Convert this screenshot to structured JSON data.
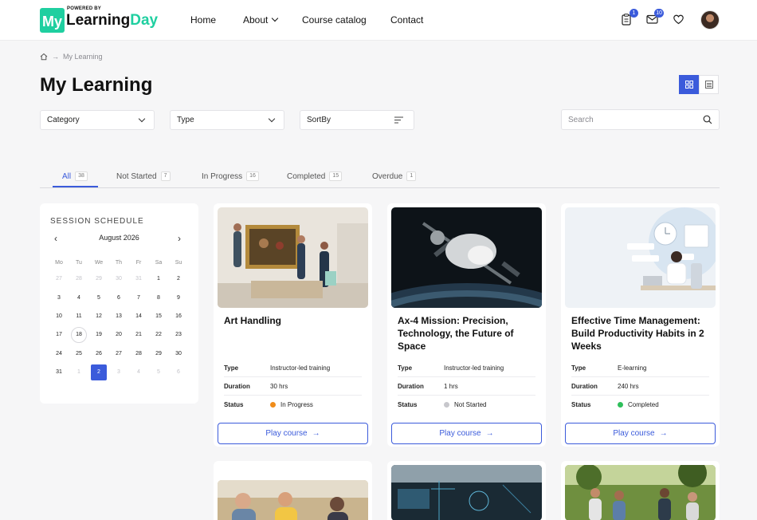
{
  "brand": {
    "powered": "POWERED BY",
    "my": "My",
    "learning": "Learning",
    "day": "Day",
    "accent": "#1fcfa0"
  },
  "nav": {
    "home": "Home",
    "about": "About",
    "catalog": "Course catalog",
    "contact": "Contact"
  },
  "header_badges": {
    "tasks": "1",
    "mail": "10"
  },
  "breadcrumb": {
    "current": "My Learning"
  },
  "page": {
    "title": "My Learning"
  },
  "filters": {
    "category": "Category",
    "type": "Type",
    "sortby": "SortBy",
    "search_placeholder": "Search"
  },
  "tabs": [
    {
      "label": "All",
      "count": "38"
    },
    {
      "label": "Not Started",
      "count": "7"
    },
    {
      "label": "In Progress",
      "count": "16"
    },
    {
      "label": "Completed",
      "count": "15"
    },
    {
      "label": "Overdue",
      "count": "1"
    }
  ],
  "calendar": {
    "heading": "SESSION SCHEDULE",
    "month": "August 2026",
    "dow": [
      "Mo",
      "Tu",
      "We",
      "Th",
      "Fr",
      "Sa",
      "Su"
    ],
    "weeks": [
      [
        "27",
        "28",
        "29",
        "30",
        "31",
        "1",
        "2"
      ],
      [
        "3",
        "4",
        "5",
        "6",
        "7",
        "8",
        "9"
      ],
      [
        "10",
        "11",
        "12",
        "13",
        "14",
        "15",
        "16"
      ],
      [
        "17",
        "18",
        "19",
        "20",
        "21",
        "22",
        "23"
      ],
      [
        "24",
        "25",
        "26",
        "27",
        "28",
        "29",
        "30"
      ],
      [
        "31",
        "1",
        "2",
        "3",
        "4",
        "5",
        "6"
      ]
    ],
    "selected": "2",
    "today": "18"
  },
  "meta_labels": {
    "type": "Type",
    "duration": "Duration",
    "status": "Status"
  },
  "courses": [
    {
      "title": "Art Handling",
      "type": "Instructor-led training",
      "duration": "30 hrs",
      "status": "In Progress",
      "status_color": "#f08c1a",
      "action": "Play course"
    },
    {
      "title": "Ax-4 Mission: Precision, Technology, the Future of Space",
      "type": "Instructor-led training",
      "duration": "1 hrs",
      "status": "Not Started",
      "status_color": "#c7c7cc",
      "action": "Play course"
    },
    {
      "title": "Effective Time Management: Build Productivity Habits in 2 Weeks",
      "type": "E-learning",
      "duration": "240 hrs",
      "status": "Completed",
      "status_color": "#2fbf5b",
      "action": "Play course"
    }
  ],
  "colors": {
    "primary": "#3b5bdb"
  }
}
